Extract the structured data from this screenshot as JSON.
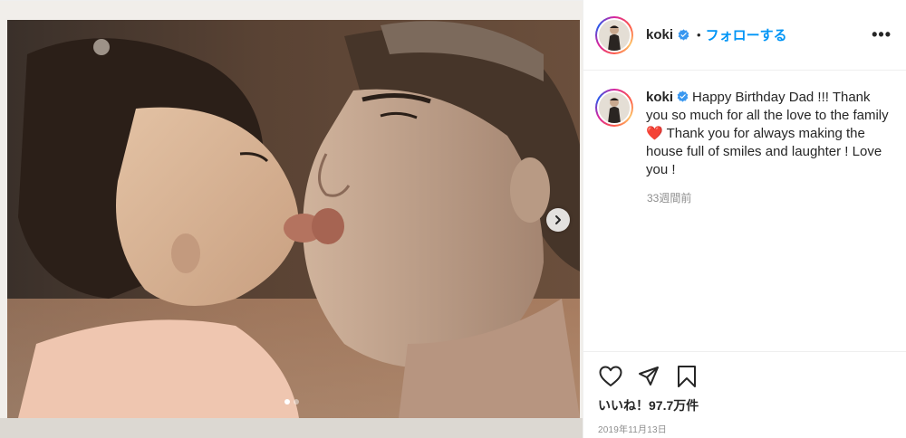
{
  "post": {
    "username": "koki",
    "verified": true,
    "bullet": "•",
    "follow_label": "フォローする",
    "more_label": "•••",
    "caption": {
      "username": "koki",
      "text_part1": "Happy Birthday Dad !!! Thank you so much for all the love to the family ",
      "emoji": "❤️",
      "text_part2": " Thank you for always making the house full of smiles and laughter ! Love you !"
    },
    "time_ago": "33週間前",
    "likes": "いいね！97.7万件",
    "date": "2019年11月13日",
    "carousel": {
      "current": 1,
      "total": 2
    }
  },
  "icons": {
    "next": "chevron-right-icon",
    "like": "heart-icon",
    "share": "paper-plane-icon",
    "save": "bookmark-icon",
    "verified": "verified-badge-icon"
  },
  "colors": {
    "link_blue": "#0095f6",
    "verified_blue": "#3897f0",
    "muted": "#8e8e8e",
    "border": "#efefef"
  }
}
